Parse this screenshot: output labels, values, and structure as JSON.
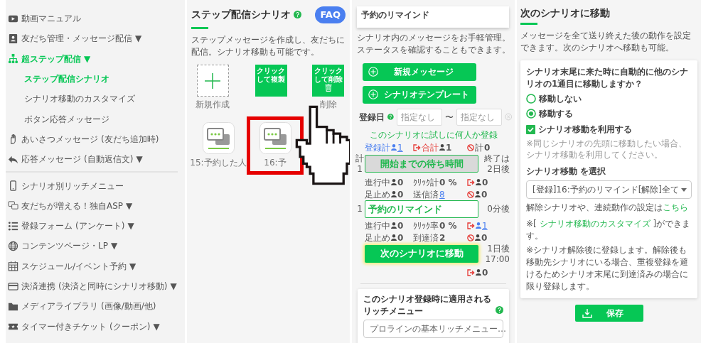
{
  "sidebar": {
    "items": [
      {
        "kind": "link",
        "label": "動画マニュアル",
        "selected": false
      },
      {
        "kind": "link",
        "label": "友だち管理・メッセージ配信",
        "caret": "▼",
        "selected": false
      },
      {
        "kind": "link",
        "label": "超ステップ配信",
        "caret": "▼",
        "selected": true,
        "children": [
          {
            "label": "ステップ配信シナリオ",
            "selected": true
          },
          {
            "label": "シナリオ移動のカスタマイズ",
            "selected": false
          },
          {
            "label": "ボタン応答メッセージ",
            "selected": false
          }
        ]
      },
      {
        "kind": "link",
        "label": "あいさつメッセージ",
        "note": "(友だち追加時)",
        "selected": false
      },
      {
        "kind": "link",
        "label": "応答メッセージ",
        "note": "(自動返信文)",
        "caret": "▼",
        "selected": false
      },
      {
        "kind": "divider"
      },
      {
        "kind": "link",
        "label": "シナリオ別リッチメニュー",
        "selected": false
      },
      {
        "kind": "link",
        "label": "友だちが増える！独自ASP",
        "caret": "▼",
        "selected": false
      },
      {
        "kind": "link",
        "label": "登録フォーム",
        "note": "(アンケート)",
        "caret": "▼",
        "selected": false
      },
      {
        "kind": "link",
        "label": "コンテンツページ・LP",
        "caret": "▼",
        "selected": false
      },
      {
        "kind": "link",
        "label": "スケジュール/イベント予約",
        "caret": "▼",
        "selected": false
      },
      {
        "kind": "link",
        "label": "決済連携",
        "note": "(決済と同時にシナリオ移動)",
        "caret": "▼",
        "selected": false
      },
      {
        "kind": "link",
        "label": "メディアライブラリ",
        "note": "(画像/動画/他)",
        "selected": false
      },
      {
        "kind": "link",
        "label": "タイマー付きチケット",
        "note": "(クーポン)",
        "caret": "▼",
        "selected": false
      }
    ]
  },
  "scenario_panel": {
    "title": "ステップ配信シナリオ",
    "faq": "FAQ",
    "description": "ステップメッセージを作成し、友だちに配信。シナリオ移動も可能です。",
    "tiles": [
      {
        "kind": "new",
        "label": "新規作成"
      },
      {
        "kind": "copy",
        "text": "クリックして複製"
      },
      {
        "kind": "delete",
        "text": "クリックして削除",
        "label": "削除"
      }
    ],
    "scenarios": [
      {
        "label": "15:予約した人",
        "selected": false
      },
      {
        "label": "16:予",
        "selected": true
      }
    ]
  },
  "messages_panel": {
    "scenario_name": "予約のリマインド",
    "description": "シナリオ内のメッセージをお手軽管理。ステータスを確認することもできます。",
    "buttons": [
      "新規メッセージ",
      "シナリオテンプレート"
    ],
    "date_filter": {
      "label": "登録日",
      "from_placeholder": "指定なし",
      "separator": "〜",
      "to_placeholder": "指定なし"
    },
    "trial_link": "このシナリオに試しに何人か登録",
    "summary": [
      [
        {
          "kind": "registered",
          "text": "登録計"
        },
        {
          "kind": "peoplelink",
          "text": "1"
        }
      ],
      [
        {
          "kind": "exit"
        },
        {
          "kind": "total",
          "text": "合計"
        },
        {
          "kind": "people",
          "text": "1"
        }
      ],
      [
        {
          "kind": "ban"
        },
        {
          "kind": "label",
          "text": "計"
        },
        {
          "kind": "count",
          "text": "0"
        }
      ]
    ],
    "steps": [
      {
        "kind": "wait",
        "left_lines": [
          "計",
          "1"
        ],
        "title": "開始までの待ち時間",
        "right_lines": [
          "終了は",
          "2日後"
        ],
        "rows": [
          [
            [
              {
                "kind": "label",
                "text": "進行中"
              },
              {
                "kind": "people",
                "text": "0"
              }
            ],
            [
              {
                "kind": "label",
                "text": "ｸﾘｯｸ計"
              },
              {
                "kind": "count",
                "text": "0 %"
              }
            ],
            [
              {
                "kind": "exit"
              },
              {
                "kind": "people",
                "text": "0"
              }
            ]
          ],
          [
            [
              {
                "kind": "label",
                "text": "足止め"
              },
              {
                "kind": "people",
                "text": "0"
              }
            ],
            [
              {
                "kind": "label",
                "text": "送信済"
              },
              {
                "kind": "link",
                "text": "8"
              }
            ],
            [
              {
                "kind": "ban"
              },
              {
                "kind": "people",
                "text": "0"
              }
            ]
          ]
        ]
      },
      {
        "kind": "message",
        "left_lines": [
          "1"
        ],
        "title": "予約のリマインド",
        "right_lines": [
          "0分後"
        ],
        "rows": [
          [
            [
              {
                "kind": "label",
                "text": "進行中"
              },
              {
                "kind": "people",
                "text": "0"
              }
            ],
            [
              {
                "kind": "label",
                "text": "ｸﾘｯｸ率"
              },
              {
                "kind": "count",
                "text": "0 %"
              }
            ],
            [
              {
                "kind": "exit"
              },
              {
                "kind": "peoplelink",
                "text": "1"
              }
            ]
          ],
          [
            [
              {
                "kind": "label",
                "text": "足止め"
              },
              {
                "kind": "people",
                "text": "0"
              }
            ],
            [
              {
                "kind": "label",
                "text": "到達済"
              },
              {
                "kind": "count",
                "text": "2"
              }
            ],
            [
              {
                "kind": "ban"
              },
              {
                "kind": "people",
                "text": "0"
              }
            ]
          ]
        ]
      },
      {
        "kind": "move",
        "title": "次のシナリオに移動",
        "right_lines": [
          "1日後",
          "17:00"
        ],
        "rows": [
          [
            [
              {
                "kind": "exit"
              },
              {
                "kind": "people",
                "text": "0"
              }
            ]
          ]
        ]
      }
    ],
    "rich_menu": {
      "title": "このシナリオ登録時に適用されるリッチメニュー",
      "select_value": "プロラインの基本リッチメニュー…"
    }
  },
  "next_panel": {
    "title": "次のシナリオに移動",
    "description": "メッセージを全て送り終えた後の動作を設定できます。次のシナリオへ移動も可能。",
    "question": "シナリオ末尾に来た時に自動的に他のシナリオの1通目に移動しますか？",
    "options": [
      {
        "label": "移動しない",
        "selected": false
      },
      {
        "label": "移動する",
        "selected": true
      }
    ],
    "use_move": {
      "label": "シナリオ移動を利用する",
      "checked": true
    },
    "use_move_note": "※同じシナリオの先頭に移動したい場合、シナリオ移動を利用してください。",
    "select_label": "シナリオ移動 を選択",
    "select_value": "[登録]16:予約のリマインド[解除]全て",
    "settings_note": {
      "text": "解除シナリオや、連続動作の設定は",
      "link": "こちら"
    },
    "customize_note": {
      "prefix": "※[ ",
      "link": "シナリオ移動のカスタマイズ",
      "suffix": " ]ができます。"
    },
    "notice": "※シナリオ解除後に登録します。解除後も移動先シナリオにいる場合、重複登録を避けるためシナリオ末尾に到達済みの場合に限り登録します。",
    "save": "保存"
  }
}
